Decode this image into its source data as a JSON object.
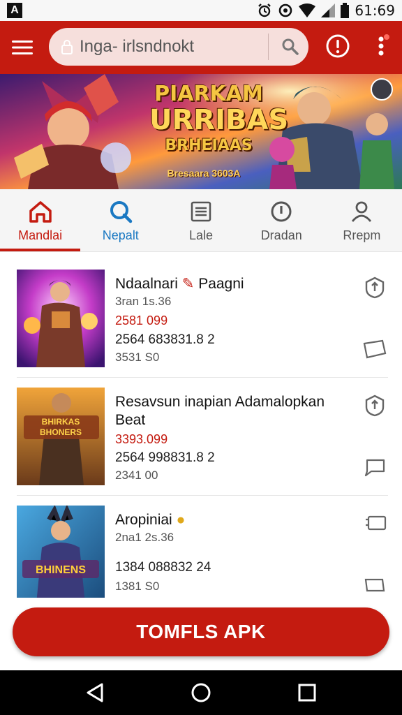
{
  "statusbar": {
    "left_glyph": "A",
    "time": "61:69"
  },
  "appbar": {
    "search_placeholder": "Inga- irlsndnokt",
    "icons": [
      "menu-icon",
      "lock-icon",
      "search-icon",
      "alert-icon",
      "more-icon"
    ]
  },
  "banner": {
    "title_line1": "PIARKAM",
    "title_line2": "URRIBAS",
    "title_line3": "BRHEIAAS",
    "subtitle": "Bresaara 3603A"
  },
  "tabs": [
    {
      "label": "Mandlai",
      "icon": "home-icon"
    },
    {
      "label": "Nepalt",
      "icon": "search-icon"
    },
    {
      "label": "Lale",
      "icon": "list-icon"
    },
    {
      "label": "Dradan",
      "icon": "info-icon"
    },
    {
      "label": "Rrepm",
      "icon": "profile-icon"
    }
  ],
  "items": [
    {
      "title": "Ndaalnari",
      "title_suffix": "Paagni",
      "sub": "3ran 1s.36",
      "price": "2581 099",
      "line": "2564 683831.8 2",
      "foot": "3531 S0"
    },
    {
      "title": "Resavsun inapian Adamalopkan Beat",
      "sub": "",
      "price": "3393.099",
      "line": "2564 998831.8 2",
      "foot": "2341 00"
    },
    {
      "title": "Aropiniai",
      "sub": "2na1 2s.36",
      "price": "",
      "line": "1384 088832 24",
      "foot": "1381 S0"
    }
  ],
  "thumb_labels": [
    "",
    "BHIRKAS BHONERS",
    "BHINENS"
  ],
  "cta": {
    "label": "TOMFLS APK"
  },
  "colors": {
    "primary": "#c41b10",
    "tab_blue": "#1a78c2"
  }
}
